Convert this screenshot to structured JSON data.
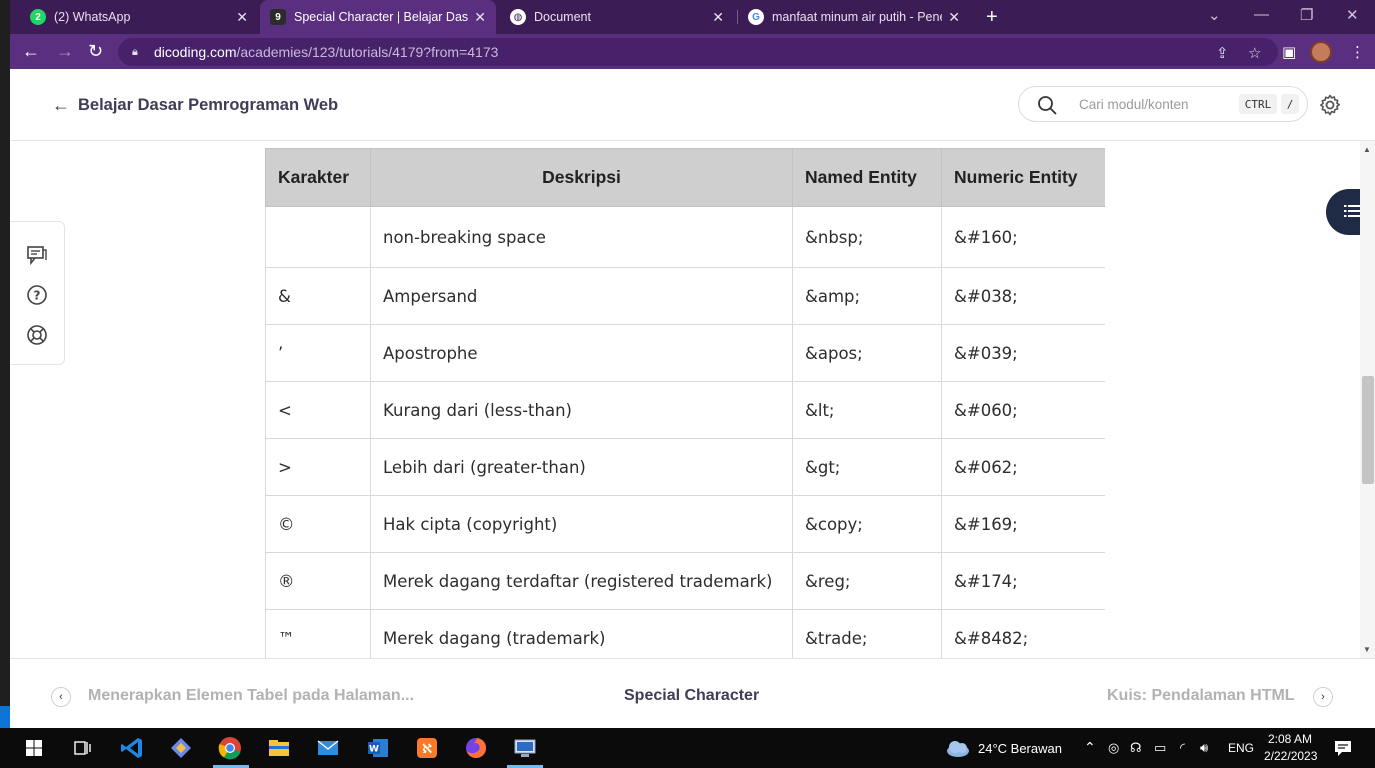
{
  "browser": {
    "tabs": [
      {
        "title": "(2) WhatsApp",
        "favicon": "whatsapp-icon",
        "active": false
      },
      {
        "title": "Special Character | Belajar Dasar P",
        "favicon": "dicoding-icon",
        "active": true
      },
      {
        "title": "Document",
        "favicon": "globe-icon",
        "active": false
      },
      {
        "title": "manfaat minum air putih - Penelu",
        "favicon": "google-icon",
        "active": false
      }
    ],
    "url_host": "dicoding.com",
    "url_path": "/academies/123/tutorials/4179?from=4173"
  },
  "header": {
    "course_title": "Belajar Dasar Pemrograman Web",
    "search_placeholder": "Cari modul/konten",
    "shortcut_key1": "CTRL",
    "shortcut_key2": "/"
  },
  "table": {
    "headers": [
      "Karakter",
      "Deskripsi",
      "Named Entity",
      "Numeric Entity"
    ],
    "rows": [
      {
        "char": "",
        "desc": "non-breaking space",
        "named": "&nbsp;",
        "numeric": "&#160;"
      },
      {
        "char": "&",
        "desc": "Ampersand",
        "named": "&amp;",
        "numeric": "&#038;"
      },
      {
        "char": "’",
        "desc": "Apostrophe",
        "named": "&apos;",
        "numeric": "&#039;"
      },
      {
        "char": "<",
        "desc": "Kurang dari (less-than)",
        "named": "&lt;",
        "numeric": "&#060;"
      },
      {
        "char": ">",
        "desc": "Lebih dari (greater-than)",
        "named": "&gt;",
        "numeric": "&#062;"
      },
      {
        "char": "©",
        "desc": "Hak cipta (copyright)",
        "named": "&copy;",
        "numeric": "&#169;"
      },
      {
        "char": "®",
        "desc": "Merek dagang terdaftar (registered trademark)",
        "named": "&reg;",
        "numeric": "&#174;"
      },
      {
        "char": "™",
        "desc": "Merek dagang (trademark)",
        "named": "&trade;",
        "numeric": "&#8482;"
      }
    ]
  },
  "footer": {
    "prev_label": "Menerapkan Elemen Tabel pada Halaman...",
    "current_label": "Special Character",
    "next_label": "Kuis: Pendalaman HTML"
  },
  "taskbar": {
    "weather": "24°C  Berawan",
    "language": "ENG",
    "time": "2:08 AM",
    "date": "2/22/2023"
  },
  "colors": {
    "tabstrip": "#3b1c55",
    "toolbar": "#5a2f80",
    "table_header": "#cfcfcf",
    "toc_button": "#1f2a44"
  }
}
